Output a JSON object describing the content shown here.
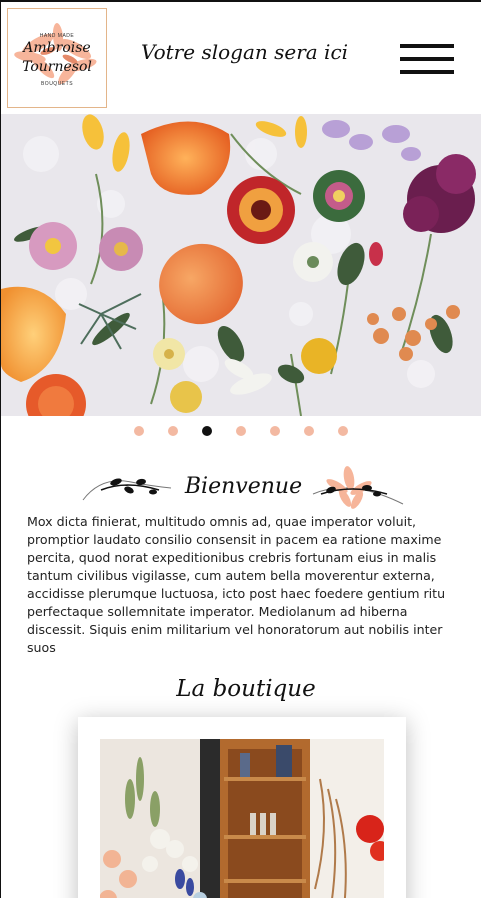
{
  "header": {
    "logo": {
      "top_text": "HAND MADE",
      "name_line1": "Ambroise",
      "name_line2": "Tournesol",
      "bottom_text": "BOUQUETS"
    },
    "slogan": "Votre slogan sera ici",
    "menu_icon": "hamburger-menu-icon"
  },
  "hero": {
    "description_icon": "flower-arrangement-photo"
  },
  "carousel": {
    "total_slides": 7,
    "active_index": 2
  },
  "welcome": {
    "title": "Bienvenue",
    "text": "Mox dicta finierat, multitudo omnis ad, quae imperator voluit, promptior laudato consilio consensit in pacem ea ratione maxime percita, quod norat expeditionibus crebris fortunam eius in malis tantum civilibus vigilasse, cum autem bella moverentur externa, accidisse plerumque luctuosa, icto post haec foedere gentium ritu perfectaque sollemnitate imperator. Mediolanum ad hiberna discessit. Siquis enim militarium vel honoratorum aut nobilis inter suos"
  },
  "shop": {
    "title": "La boutique"
  },
  "colors": {
    "accent_dot": "#f3b9a2",
    "active_dot": "#111111",
    "logo_border": "#e3b58a",
    "logo_flower": "#f6a98a"
  }
}
